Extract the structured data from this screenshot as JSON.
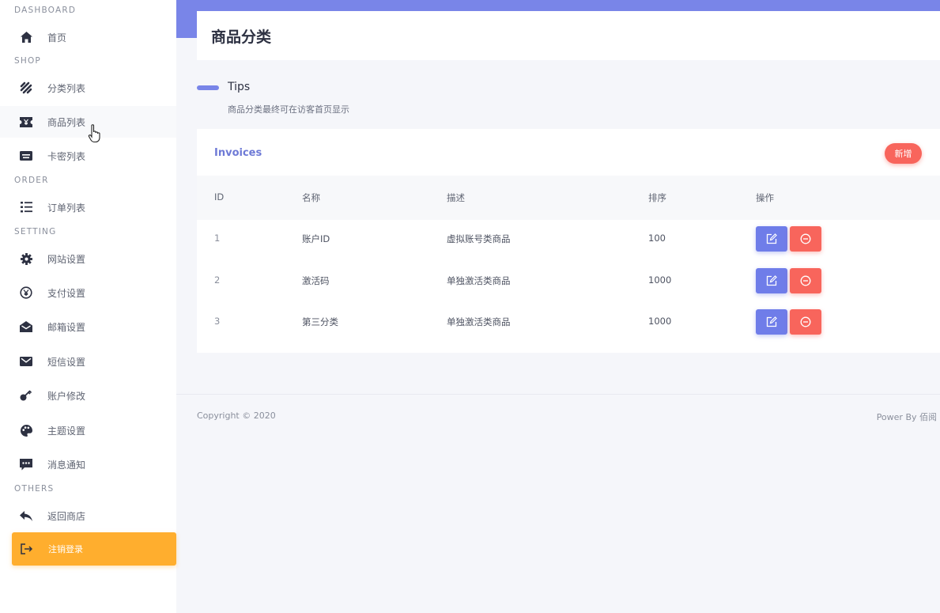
{
  "sidebar": {
    "sections": {
      "dashboard": "DASHBOARD",
      "shop": "SHOP",
      "order": "ORDER",
      "setting": "SETTING",
      "others": "OTHERS"
    },
    "items": {
      "home": "首页",
      "category_list": "分类列表",
      "product_list": "商品列表",
      "card_list": "卡密列表",
      "order_list": "订单列表",
      "site_settings": "网站设置",
      "payment_settings": "支付设置",
      "email_settings": "邮箱设置",
      "sms_settings": "短信设置",
      "account_edit": "账户修改",
      "theme_settings": "主题设置",
      "notifications": "消息通知",
      "back_to_shop": "返回商店",
      "logout": "注销登录"
    }
  },
  "header": {
    "title": "商品分类"
  },
  "tips": {
    "title": "Tips",
    "text": "商品分类最终可在访客首页显示"
  },
  "card": {
    "title": "Invoices",
    "add_label": "新增",
    "columns": {
      "id": "ID",
      "name": "名称",
      "desc": "描述",
      "sort": "排序",
      "action": "操作"
    },
    "rows": [
      {
        "id": "1",
        "name": "账户ID",
        "desc": "虚拟账号类商品",
        "sort": "100"
      },
      {
        "id": "2",
        "name": "激活码",
        "desc": "单独激活类商品",
        "sort": "1000"
      },
      {
        "id": "3",
        "name": "第三分类",
        "desc": "单独激活类商品",
        "sort": "1000"
      }
    ]
  },
  "footer": {
    "copyright": "Copyright © 2020",
    "powered": "Power By 佰阅"
  },
  "colors": {
    "accent": "#7985e8",
    "danger": "#f8655c",
    "warning": "#ffae2e"
  },
  "icons": {
    "home": "home-icon",
    "category_list": "grid-pattern-icon",
    "product_list": "ticket-icon",
    "card_list": "keyboard-icon",
    "order_list": "list-icon",
    "site_settings": "gear-icon",
    "payment_settings": "yen-circle-icon",
    "email_settings": "envelope-open-icon",
    "sms_settings": "envelope-icon",
    "account_edit": "key-icon",
    "theme_settings": "palette-icon",
    "notifications": "chat-icon",
    "back_to_shop": "reply-icon",
    "logout": "logout-icon",
    "edit": "edit-icon",
    "delete": "minus-circle-icon"
  }
}
